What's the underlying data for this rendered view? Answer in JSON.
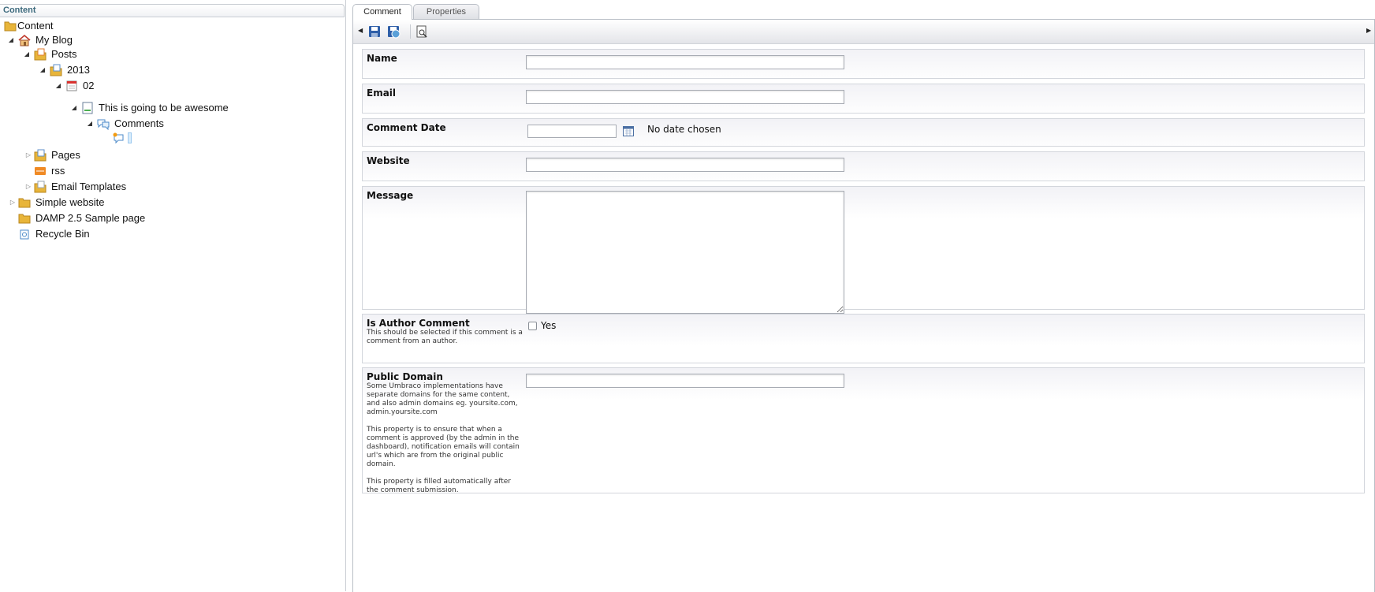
{
  "tree": {
    "header": "Content",
    "nodes": [
      {
        "label": "Content",
        "icon": "folder-icon"
      },
      {
        "label": "My Blog",
        "icon": "home-icon"
      },
      {
        "label": "Posts",
        "icon": "folder-doc-icon"
      },
      {
        "label": "2013",
        "icon": "folder-doc-icon"
      },
      {
        "label": "02",
        "icon": "calendar-icon"
      },
      {
        "label": "This is going to be awesome",
        "icon": "document-icon"
      },
      {
        "label": "Comments",
        "icon": "comments-icon"
      },
      {
        "label": "",
        "icon": "comment-new-icon"
      },
      {
        "label": "Pages",
        "icon": "folder-doc-icon"
      },
      {
        "label": "rss",
        "icon": "rss-icon"
      },
      {
        "label": "Email Templates",
        "icon": "folder-doc-icon"
      },
      {
        "label": "Simple website",
        "icon": "folder-icon"
      },
      {
        "label": "DAMP 2.5 Sample page",
        "icon": "folder-icon"
      },
      {
        "label": "Recycle Bin",
        "icon": "recycle-bin-icon"
      }
    ]
  },
  "tabs": [
    "Comment",
    "Properties"
  ],
  "toolbar": {
    "icons": [
      "save-icon",
      "save-publish-icon",
      "preview-icon"
    ]
  },
  "form": {
    "name": {
      "label": "Name",
      "value": ""
    },
    "email": {
      "label": "Email",
      "value": ""
    },
    "comment_date": {
      "label": "Comment Date",
      "value": "",
      "status": "No date chosen"
    },
    "website": {
      "label": "Website",
      "value": ""
    },
    "message": {
      "label": "Message",
      "value": ""
    },
    "is_author": {
      "label": "Is Author Comment",
      "description": "This should be selected if this comment is a comment from an author.",
      "checkbox_label": "Yes",
      "checked": false
    },
    "public_domain": {
      "label": "Public Domain",
      "description": "Some Umbraco implementations have separate domains for the same content, and also admin domains eg. yoursite.com, admin.yoursite.com\n\nThis property is to ensure that when a comment is approved (by the admin in the dashboard), notification emails will contain url's which are from the original public domain.\n\nThis property is filled automatically after the comment submission.",
      "value": ""
    }
  },
  "colors": {
    "accent": "#3d6a7d",
    "border": "#d3d6dc",
    "folder": "#e8b53a"
  }
}
